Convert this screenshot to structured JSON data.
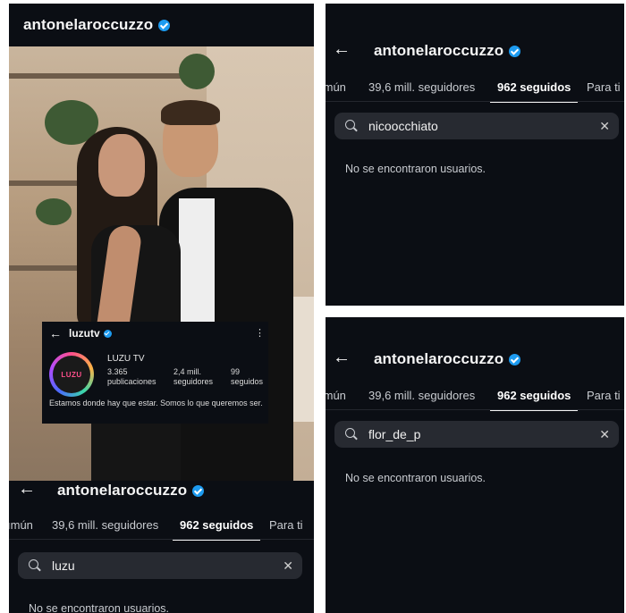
{
  "username": "antonelaroccuzzo",
  "tabs": {
    "common": "ımún",
    "followers": "39,6 mill. seguidores",
    "following": "962 seguidos",
    "foryou": "Para ti"
  },
  "no_results": "No se encontraron usuarios.",
  "left_panel": {
    "search_query": "luzu",
    "popup": {
      "username": "luzutv",
      "display_name": "LUZU TV",
      "avatar_text": "LUZU",
      "posts_count": "3.365",
      "posts_label": "publicaciones",
      "followers_count": "2,4 mill.",
      "followers_label": "seguidores",
      "following_count": "99",
      "following_label": "seguidos",
      "bio": "Estamos donde hay que estar. Somos lo que queremos ser."
    }
  },
  "right_top": {
    "search_query": "nicoocchiato"
  },
  "right_bottom": {
    "search_query": "flor_de_p"
  },
  "colors": {
    "background": "#0b0e14",
    "verified": "#1d9bf0",
    "search_bg": "#272a31"
  }
}
